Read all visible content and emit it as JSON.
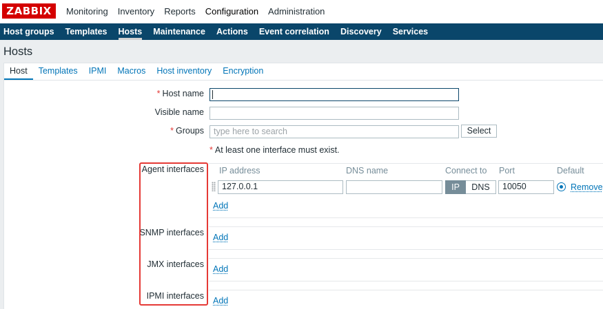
{
  "logo": "ZABBIX",
  "top_nav": [
    "Monitoring",
    "Inventory",
    "Reports",
    "Configuration",
    "Administration"
  ],
  "top_nav_active": "Configuration",
  "sub_nav": [
    "Host groups",
    "Templates",
    "Hosts",
    "Maintenance",
    "Actions",
    "Event correlation",
    "Discovery",
    "Services"
  ],
  "sub_nav_active": "Hosts",
  "page_title": "Hosts",
  "tabs": [
    "Host",
    "Templates",
    "IPMI",
    "Macros",
    "Host inventory",
    "Encryption"
  ],
  "active_tab": "Host",
  "form": {
    "host_name_label": "Host name",
    "host_name_value": "",
    "visible_name_label": "Visible name",
    "visible_name_value": "",
    "groups_label": "Groups",
    "groups_placeholder": "type here to search",
    "select_button": "Select",
    "required_mark": "*",
    "interface_note": "At least one interface must exist."
  },
  "interfaces": {
    "agent_label": "Agent interfaces",
    "snmp_label": "SNMP interfaces",
    "jmx_label": "JMX interfaces",
    "ipmi_label": "IPMI interfaces",
    "headers": {
      "ip_address": "IP address",
      "dns_name": "DNS name",
      "connect_to": "Connect to",
      "port": "Port",
      "default": "Default"
    },
    "agent_row": {
      "ip": "127.0.0.1",
      "dns": "",
      "connect_ip": "IP",
      "connect_dns": "DNS",
      "connect_selected": "IP",
      "port": "10050",
      "default_selected": true,
      "remove": "Remove"
    },
    "add_label": "Add"
  },
  "colors": {
    "logo_red": "#d40000",
    "subnav_bg": "#0a466a",
    "link_blue": "#0275b8",
    "required_red": "#e33734",
    "highlight_box": "#e53935"
  }
}
